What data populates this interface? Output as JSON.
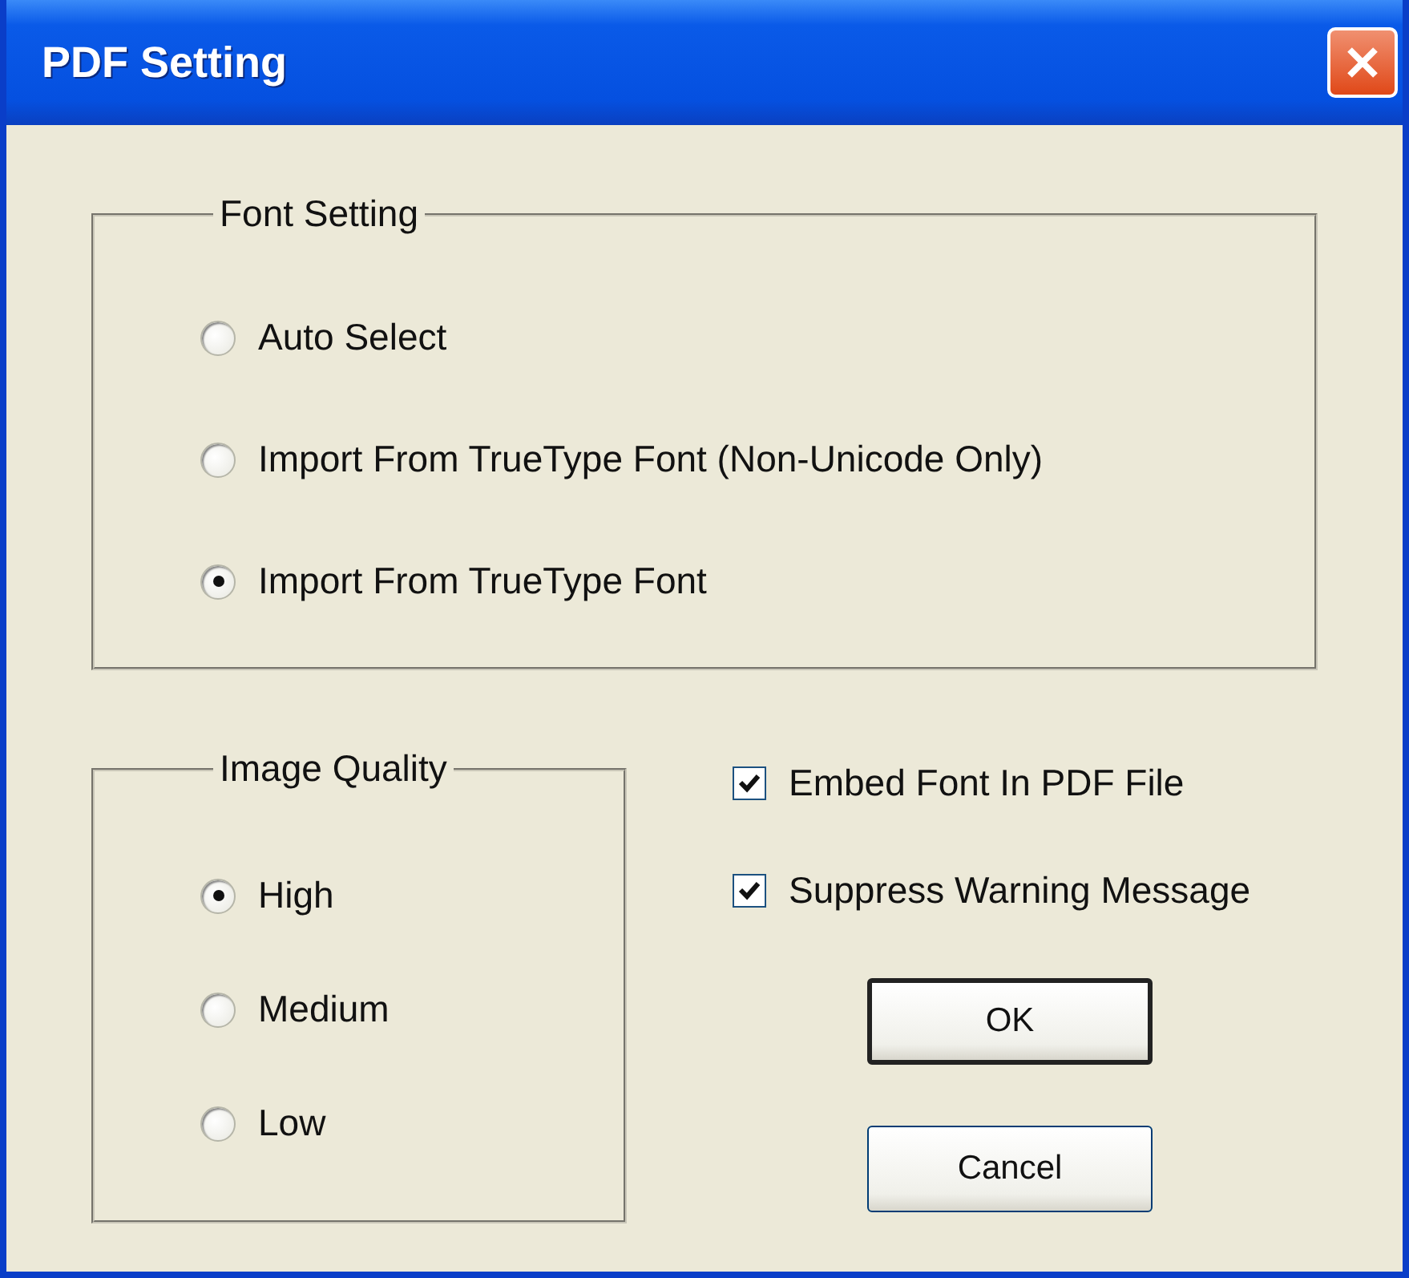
{
  "window": {
    "title": "PDF Setting"
  },
  "font_setting": {
    "label": "Font Setting",
    "options": [
      {
        "label": "Auto Select",
        "selected": false
      },
      {
        "label": "Import From TrueType Font (Non-Unicode Only)",
        "selected": false
      },
      {
        "label": "Import From TrueType Font",
        "selected": true
      }
    ]
  },
  "image_quality": {
    "label": "Image Quality",
    "options": [
      {
        "label": "High",
        "selected": true
      },
      {
        "label": "Medium",
        "selected": false
      },
      {
        "label": "Low",
        "selected": false
      }
    ]
  },
  "checkboxes": [
    {
      "label": "Embed Font In PDF File",
      "checked": true
    },
    {
      "label": "Suppress Warning Message",
      "checked": true
    }
  ],
  "buttons": [
    {
      "label": "OK",
      "default": true
    },
    {
      "label": "Cancel",
      "default": false
    }
  ]
}
